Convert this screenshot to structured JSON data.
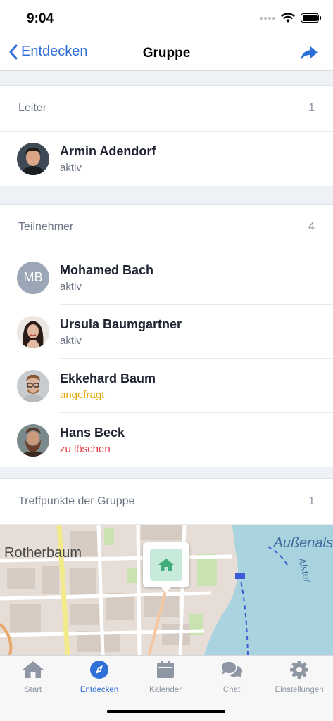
{
  "status_bar": {
    "time": "9:04"
  },
  "nav": {
    "back_label": "Entdecken",
    "title": "Gruppe",
    "share_icon": "share-icon"
  },
  "sections": {
    "leader": {
      "label": "Leiter",
      "count": "1",
      "people": [
        {
          "name": "Armin Adendorf",
          "status": "aktiv",
          "status_type": "active"
        }
      ]
    },
    "participants": {
      "label": "Teilnehmer",
      "count": "4",
      "people": [
        {
          "name": "Mohamed Bach",
          "status": "aktiv",
          "status_type": "active",
          "initials": "MB"
        },
        {
          "name": "Ursula Baumgartner",
          "status": "aktiv",
          "status_type": "active"
        },
        {
          "name": "Ekkehard Baum",
          "status": "angefragt",
          "status_type": "pending"
        },
        {
          "name": "Hans Beck",
          "status": "zu löschen",
          "status_type": "delete"
        }
      ]
    },
    "meeting_points": {
      "label": "Treffpunkte der Gruppe",
      "count": "1"
    }
  },
  "map": {
    "label_district": "Rotherbaum",
    "label_water": "Außenals",
    "label_river": "Alster",
    "pin_icon": "home-icon"
  },
  "tabs": [
    {
      "label": "Start",
      "icon": "home-icon",
      "active": false
    },
    {
      "label": "Entdecken",
      "icon": "compass-icon",
      "active": true
    },
    {
      "label": "Kalender",
      "icon": "calendar-icon",
      "active": false
    },
    {
      "label": "Chat",
      "icon": "chat-icon",
      "active": false
    },
    {
      "label": "Einstellungen",
      "icon": "gear-icon",
      "active": false
    }
  ],
  "colors": {
    "accent": "#2f6fd8",
    "pending": "#e0a800",
    "delete": "#e5393f",
    "pin_bg": "#c7eadb",
    "pin_icon": "#3fae7a"
  }
}
